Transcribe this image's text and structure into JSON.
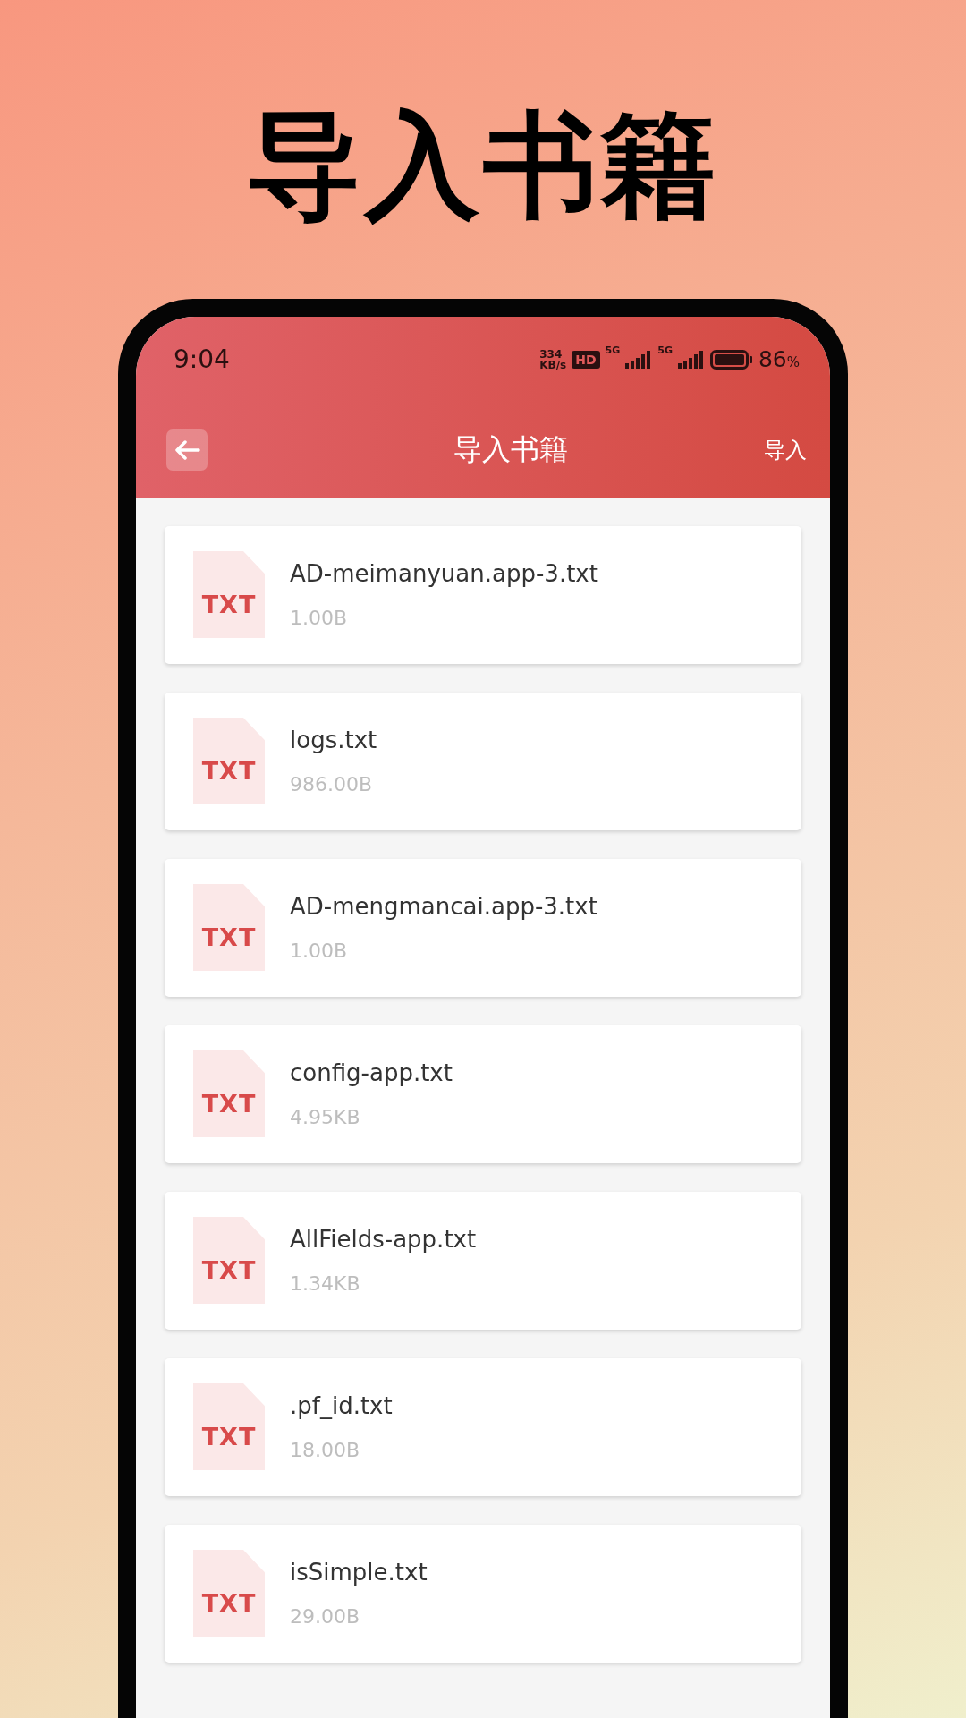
{
  "headline": "导入书籍",
  "status_bar": {
    "time": "9:04",
    "speed_value": "334",
    "speed_unit": "KB/s",
    "hd_badge": "HD",
    "network_1": "5G",
    "network_2": "5G",
    "battery_level": "86",
    "battery_unit": "%"
  },
  "toolbar": {
    "title": "导入书籍",
    "action": "导入"
  },
  "files": [
    {
      "icon_label": "TXT",
      "name": "AD-meimanyuan.app-3.txt",
      "size": "1.00B"
    },
    {
      "icon_label": "TXT",
      "name": "logs.txt",
      "size": "986.00B"
    },
    {
      "icon_label": "TXT",
      "name": "AD-mengmancai.app-3.txt",
      "size": "1.00B"
    },
    {
      "icon_label": "TXT",
      "name": "config-app.txt",
      "size": "4.95KB"
    },
    {
      "icon_label": "TXT",
      "name": "AllFields-app.txt",
      "size": "1.34KB"
    },
    {
      "icon_label": "TXT",
      "name": ".pf_id.txt",
      "size": "18.00B"
    },
    {
      "icon_label": "TXT",
      "name": "isSimple.txt",
      "size": "29.00B"
    }
  ]
}
